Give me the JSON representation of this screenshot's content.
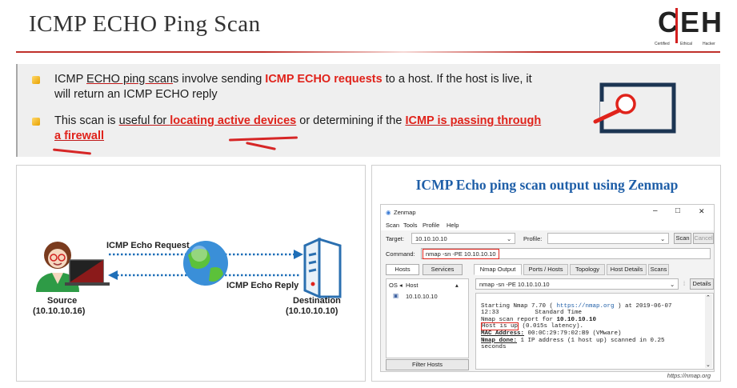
{
  "header": {
    "title": "ICMP ECHO Ping Scan",
    "logo": {
      "c": "C",
      "e": "E",
      "h": "H",
      "sub1": "Certified",
      "sub2": "Ethical",
      "sub3": "Hacker"
    }
  },
  "bullets": {
    "b1": {
      "t1": "ICMP ",
      "t2": "ECHO ping scan",
      "t3": "s involve sending ",
      "t4": "ICMP ECHO requests",
      "t5": " to a host. If the host is live, it",
      "t6": "will return an ICMP ECHO reply"
    },
    "b2": {
      "t1": "This scan is ",
      "t2": "useful for ",
      "t3": "locating active devices",
      "t4": " or determining if the ",
      "t5": "ICMP is passing through",
      "t6": "a firewall"
    }
  },
  "diagram": {
    "request": "ICMP Echo Request",
    "reply": "ICMP Echo Reply",
    "source_label": "Source",
    "source_ip": "(10.10.10.16)",
    "dest_label": "Destination",
    "dest_ip": "(10.10.10.10)"
  },
  "zenmap": {
    "heading": "ICMP Echo ping scan output using Zenmap",
    "app_title": "Zenmap",
    "win_min": "–",
    "win_max": "□",
    "win_close": "✕",
    "menu": [
      "Scan",
      "Tools",
      "Profile",
      "Help"
    ],
    "target_label": "Target:",
    "target_value": "10.10.10.10",
    "profile_label": "Profile:",
    "profile_value": "",
    "scan_button": "Scan",
    "cancel_button": "Cancel",
    "command_label": "Command:",
    "command_value": "nmap -sn -PE 10.10.10.10",
    "hosts_tab": "Hosts",
    "services_tab": "Services",
    "col_os": "OS",
    "col_host": "Host",
    "host_row": "10.10.10.10",
    "filter_button": "Filter Hosts",
    "tabs": [
      "Nmap Output",
      "Ports / Hosts",
      "Topology",
      "Host Details",
      "Scans"
    ],
    "output_select": "nmap -sn -PE 10.10.10.10",
    "details_button": "Details",
    "output": {
      "l1a": "Starting Nmap 7.70 ( ",
      "l1link": "https://nmap.org",
      "l1b": " ) at 2019-06-07",
      "l2": "12:33          Standard Time",
      "l3a": "Nmap scan report for ",
      "l3b": "10.10.10.10",
      "l4a": "Host is up",
      "l4b": " (0.015s latency).",
      "l5a": "MAC Address:",
      "l5b": " 00:0C:29:79:02:B9 (VMware)",
      "l6a": "Nmap done:",
      "l6b": " 1 IP address (1 host up) scanned in 0.25",
      "l7": "seconds"
    },
    "footnote": "https://nmap.org"
  },
  "colors": {
    "accent_red": "#e0231b",
    "heading_blue": "#1f5fa8",
    "arrow_blue": "#1f6fb8"
  },
  "icons": [
    "search-icon",
    "globe-icon",
    "server-icon",
    "laptop-icon",
    "person-icon"
  ]
}
